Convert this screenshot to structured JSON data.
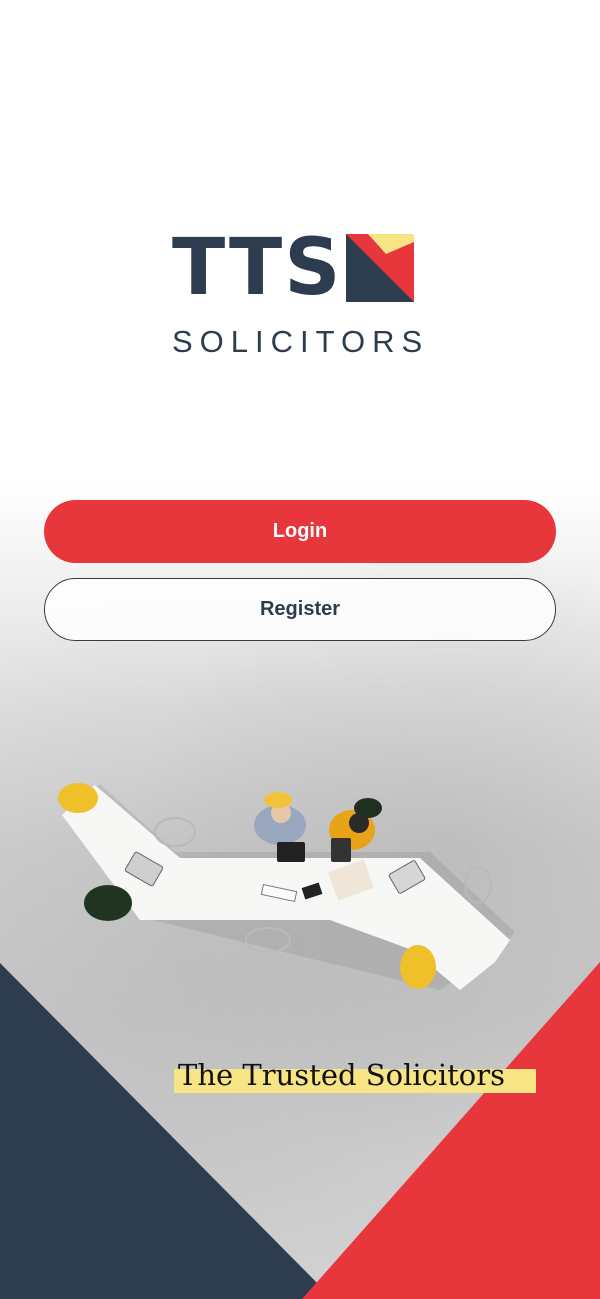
{
  "brand": {
    "name": "TTS",
    "subtitle": "SOLICITORS",
    "colors": {
      "navy": "#2d3c4e",
      "red": "#e8363d",
      "yellow": "#f7e485"
    }
  },
  "actions": {
    "login_label": "Login",
    "register_label": "Register"
  },
  "tagline": "The Trusted Solicitors",
  "background": {
    "image": "office-table-aerial-photo-icon"
  }
}
